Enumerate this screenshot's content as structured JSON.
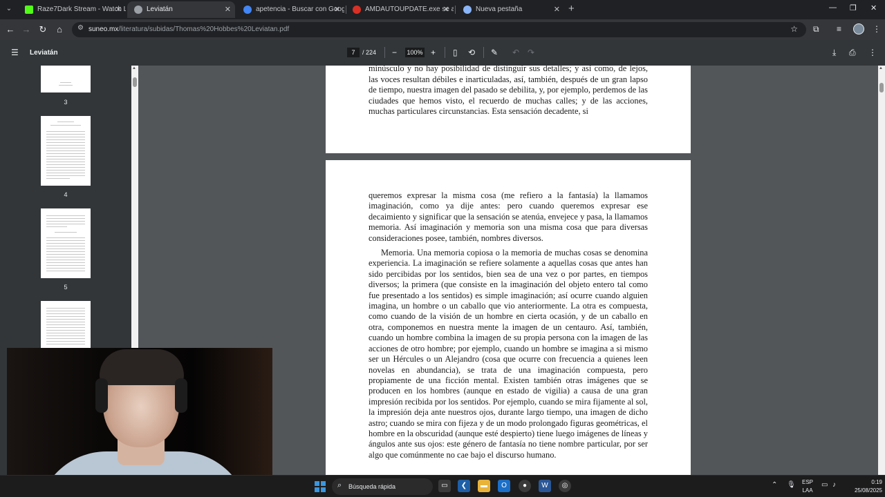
{
  "tabs": [
    {
      "title": "Raze7Dark Stream - Watch Live",
      "favicon_color": "#53fc18",
      "active": false
    },
    {
      "title": "Leviatán",
      "favicon_color": "#9aa0a6",
      "active": true
    },
    {
      "title": "apetencia - Buscar con Google",
      "favicon_color": "#4285f4",
      "active": false
    },
    {
      "title": "AMDAUTOUPDATE.exe se abrió",
      "favicon_color": "#d93025",
      "active": false
    },
    {
      "title": "Nueva pestaña",
      "favicon_color": "#8ab4f8",
      "active": false
    }
  ],
  "toolbar": {
    "url_host": "suneo.mx",
    "url_path": "/literatura/subidas/Thomas%20Hobbes%20Leviatan.pdf"
  },
  "pdf": {
    "title": "Leviatán",
    "current_page": "7",
    "total_pages": "/ 224",
    "zoom": "100%"
  },
  "thumbnails": [
    {
      "page": "3"
    },
    {
      "page": "4"
    },
    {
      "page": "5"
    },
    {
      "page": "6"
    }
  ],
  "page_top": {
    "lines": "modo que a gran distancia de un lugar el objeto a que miramos aparece minúsculo y no hay posibilidad de distinguir sus detalles; y así como, de lejos, las voces resultan débiles e inarticuladas, así, también, después de un gran lapso de tiempo, nuestra imagen del pasado se debilita, y, por ejemplo, perdemos de las ciudades que hemos visto, el recuerdo de muchas calles; y de las acciones, muchas particulares circunstancias. Esta sensación decadente, si"
  },
  "page_main": {
    "para1": "queremos expresar la misma cosa (me refiero a la fantasía) la llamamos imaginación, como ya dije antes: pero cuando queremos expresar ese decaimiento y significar que la sensación se atenúa, envejece y pasa, la llamamos memoria. Así imaginación y memoria son una misma cosa que para diversas consideraciones posee, también, nombres diversos.",
    "para2": "Memoria. Una memoria copiosa o la memoria de muchas cosas se denomina experiencia. La imaginación se refiere solamente a aquellas cosas que antes han sido percibidas por los sentidos, bien sea de una vez o por partes, en tiempos diversos; la primera (que consiste en la imaginación del objeto entero tal como fue presentado a los sentidos) es simple imaginación; así ocurre cuando alguien imagina, un hombre o un caballo que vio anteriormente. La otra es compuesta, como cuando de la visión de un hombre en cierta ocasión, y de un caballo en otra, componemos en nuestra mente la imagen de un centauro. Así, también, cuando un hombre combina la imagen de su propia persona con la imagen de las acciones de otro hombre; por ejemplo, cuando un hombre se imagina a si mismo ser un Hércules o un Alejandro (cosa que ocurre con frecuencia a quienes leen novelas en abundancia), se trata de una imaginación compuesta, pero propiamente de una ficción mental. Existen también otras imágenes que se producen en los hombres (aunque en estado de vigilia) a causa de una gran impresión recibida por los sentidos. Por ejemplo, cuando se mira fijamente al sol, la impresión deja ante nuestros ojos, durante largo tiempo, una imagen de dicho astro; cuando se mira con fijeza y de un modo prolongado figuras geométricas, el hombre en la obscuridad (aunque esté despierto) tiene luego imágenes de líneas y ángulos ante sus ojos: este género de fantasía no tiene nombre particular, por ser algo que comúnmente no cae bajo el discurso humano."
  },
  "taskbar": {
    "search_label": "Búsqueda rápida",
    "lang_1": "ESP",
    "lang_2": "LAA",
    "time": "0:19",
    "date": "25/08/2025"
  }
}
